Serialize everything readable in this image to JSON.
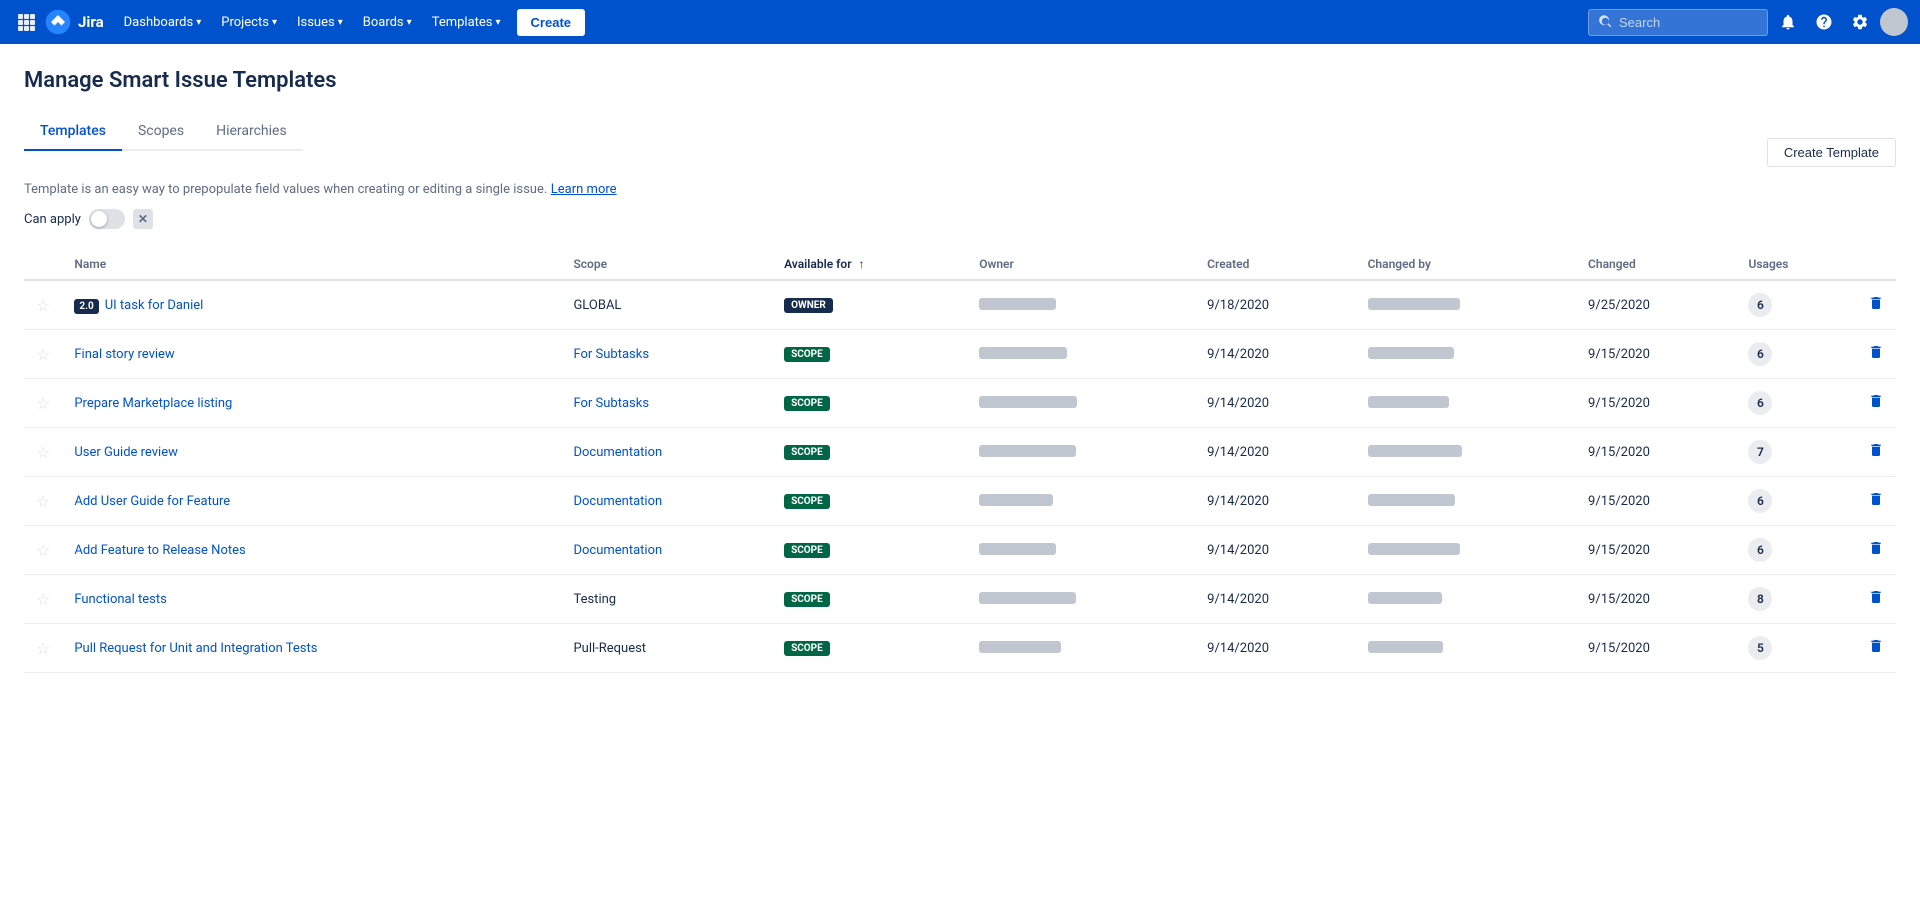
{
  "nav": {
    "logo_text": "Jira",
    "dashboards": "Dashboards",
    "projects": "Projects",
    "issues": "Issues",
    "boards": "Boards",
    "templates": "Templates",
    "create": "Create",
    "search_placeholder": "Search"
  },
  "page": {
    "title": "Manage Smart Issue Templates",
    "tabs": [
      "Templates",
      "Scopes",
      "Hierarchies"
    ],
    "active_tab": 0,
    "description": "Template is an easy way to prepopulate field values when creating or editing a single issue.",
    "learn_more": "Learn more",
    "create_button": "Create Template",
    "can_apply_label": "Can apply"
  },
  "table": {
    "columns": [
      "Name",
      "Scope",
      "Available for",
      "Owner",
      "Created",
      "Changed by",
      "Changed",
      "Usages",
      ""
    ],
    "sort_column": "Available for",
    "rows": [
      {
        "star": false,
        "version_badge": "2.0",
        "name": "UI task for Daniel",
        "scope": "GLOBAL",
        "scope_type": "plain",
        "available_badge": "OWNER",
        "available_type": "owner",
        "owner_blurred": true,
        "created": "9/18/2020",
        "changed_by_blurred": true,
        "changed": "9/25/2020",
        "usages": "6"
      },
      {
        "star": false,
        "version_badge": null,
        "name": "Final story review",
        "scope": "For Subtasks",
        "scope_type": "link",
        "available_badge": "SCOPE",
        "available_type": "scope",
        "owner_blurred": true,
        "created": "9/14/2020",
        "changed_by_blurred": true,
        "changed": "9/15/2020",
        "usages": "6"
      },
      {
        "star": false,
        "version_badge": null,
        "name": "Prepare Marketplace listing",
        "scope": "For Subtasks",
        "scope_type": "link",
        "available_badge": "SCOPE",
        "available_type": "scope",
        "owner_blurred": true,
        "created": "9/14/2020",
        "changed_by_blurred": true,
        "changed": "9/15/2020",
        "usages": "6"
      },
      {
        "star": false,
        "version_badge": null,
        "name": "User Guide review",
        "scope": "Documentation",
        "scope_type": "link",
        "available_badge": "SCOPE",
        "available_type": "scope",
        "owner_blurred": true,
        "created": "9/14/2020",
        "changed_by_blurred": true,
        "changed": "9/15/2020",
        "usages": "7"
      },
      {
        "star": false,
        "version_badge": null,
        "name": "Add User Guide for Feature",
        "scope": "Documentation",
        "scope_type": "link",
        "available_badge": "SCOPE",
        "available_type": "scope",
        "owner_blurred": true,
        "created": "9/14/2020",
        "changed_by_blurred": true,
        "changed": "9/15/2020",
        "usages": "6"
      },
      {
        "star": false,
        "version_badge": null,
        "name": "Add Feature to Release Notes",
        "scope": "Documentation",
        "scope_type": "link",
        "available_badge": "SCOPE",
        "available_type": "scope",
        "owner_blurred": true,
        "created": "9/14/2020",
        "changed_by_blurred": true,
        "changed": "9/15/2020",
        "usages": "6"
      },
      {
        "star": false,
        "version_badge": null,
        "name": "Functional tests",
        "scope": "Testing",
        "scope_type": "plain",
        "available_badge": "SCOPE",
        "available_type": "scope",
        "owner_blurred": true,
        "created": "9/14/2020",
        "changed_by_blurred": true,
        "changed": "9/15/2020",
        "usages": "8"
      },
      {
        "star": false,
        "version_badge": null,
        "name": "Pull Request for Unit and Integration Tests",
        "scope": "Pull-Request",
        "scope_type": "plain",
        "available_badge": "SCOPE",
        "available_type": "scope",
        "owner_blurred": true,
        "created": "9/14/2020",
        "changed_by_blurred": true,
        "changed": "9/15/2020",
        "usages": "5"
      }
    ]
  }
}
